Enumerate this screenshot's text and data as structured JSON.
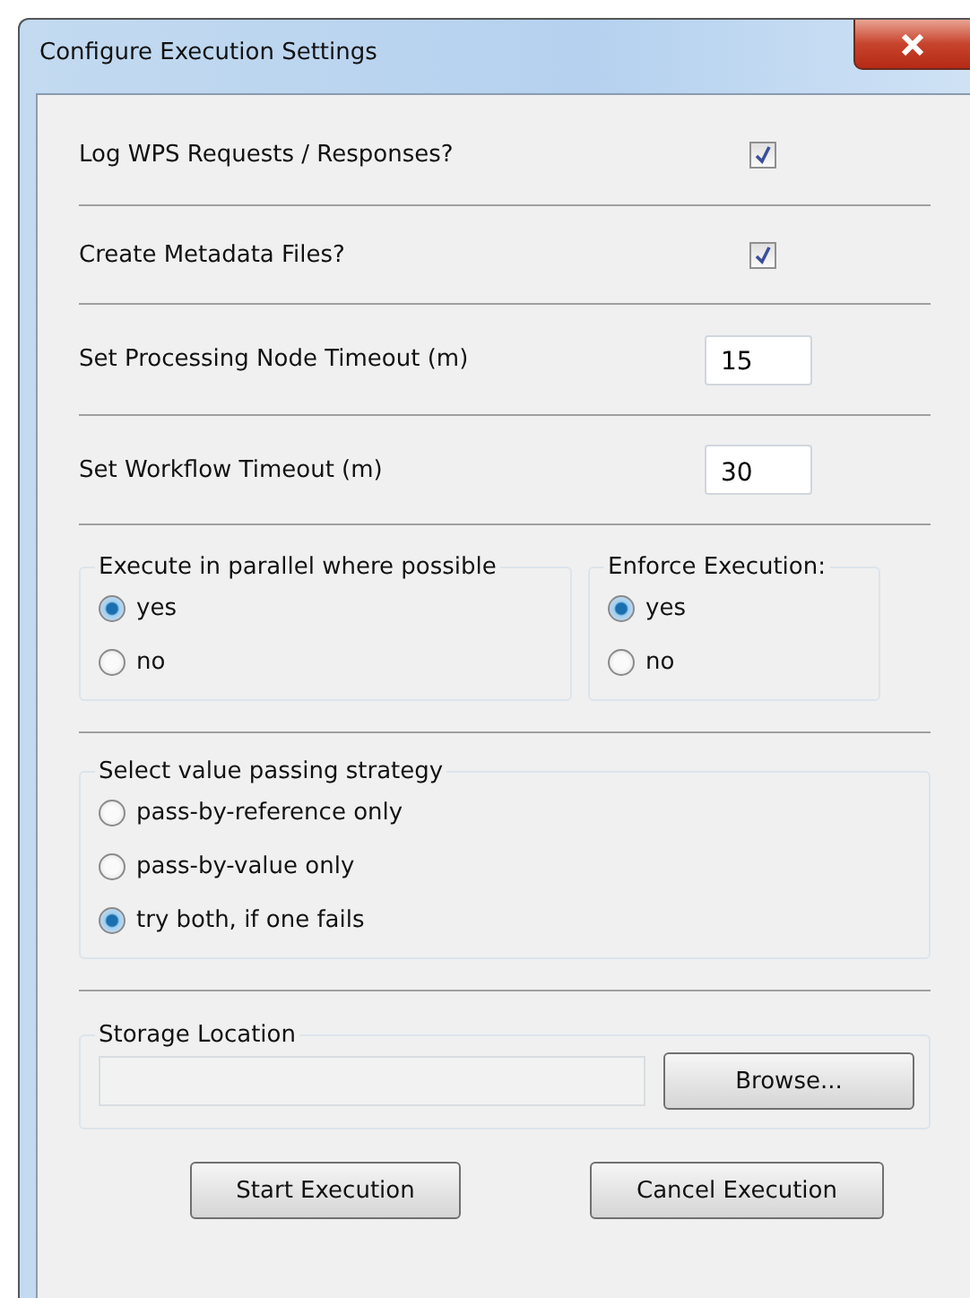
{
  "window": {
    "title": "Configure Execution Settings"
  },
  "settings": [
    {
      "kind": "checkbox",
      "label": "Log WPS Requests / Responses?",
      "checked": true
    },
    {
      "kind": "checkbox",
      "label": "Create Metadata Files?",
      "checked": true
    },
    {
      "kind": "field",
      "label": "Set Processing Node Timeout (m)",
      "value": "15"
    },
    {
      "kind": "field",
      "label": "Set Workflow Timeout (m)",
      "value": "30"
    }
  ],
  "radio_rows": [
    [
      {
        "title": "Execute in parallel where possible",
        "options": [
          {
            "label": "yes",
            "selected": true
          },
          {
            "label": "no",
            "selected": false
          }
        ]
      },
      {
        "title": "Enforce Execution:",
        "options": [
          {
            "label": "yes",
            "selected": true
          },
          {
            "label": "no",
            "selected": false
          }
        ]
      }
    ],
    [
      {
        "title": "Select value passing strategy",
        "options": [
          {
            "label": "pass-by-reference only",
            "selected": false
          },
          {
            "label": "pass-by-value only",
            "selected": false
          },
          {
            "label": "try both, if one fails",
            "selected": true
          }
        ]
      }
    ]
  ],
  "storage": {
    "title": "Storage Location",
    "button": "Browse..."
  },
  "buttons": [
    "Start Execution",
    "Cancel Execution"
  ]
}
